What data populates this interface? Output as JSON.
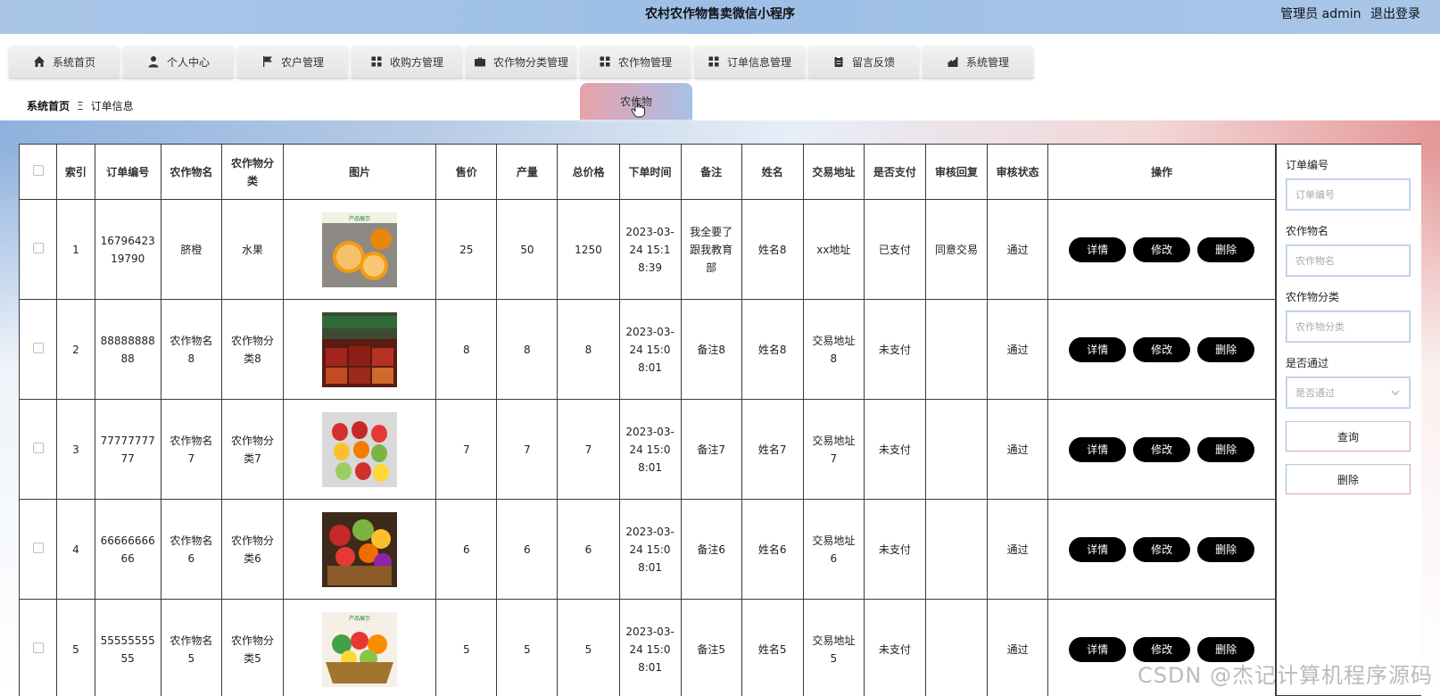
{
  "header": {
    "title": "农村农作物售卖微信小程序",
    "user_label": "管理员 admin",
    "logout_label": "退出登录"
  },
  "nav": {
    "items": [
      {
        "label": "系统首页",
        "icon": "home-icon"
      },
      {
        "label": "个人中心",
        "icon": "user-icon"
      },
      {
        "label": "农户管理",
        "icon": "flag-icon"
      },
      {
        "label": "收购方管理",
        "icon": "grid-icon"
      },
      {
        "label": "农作物分类管理",
        "icon": "briefcase-icon"
      },
      {
        "label": "农作物管理",
        "icon": "grid-icon"
      },
      {
        "label": "订单信息管理",
        "icon": "grid-icon"
      },
      {
        "label": "留言反馈",
        "icon": "clipboard-icon"
      },
      {
        "label": "系统管理",
        "icon": "settings-icon"
      }
    ],
    "dropdown_item": "农作物"
  },
  "breadcrumb": {
    "home": "系统首页",
    "separator": "Ξ",
    "current": "订单信息"
  },
  "table": {
    "headers": [
      "索引",
      "订单编号",
      "农作物名",
      "农作物分类",
      "图片",
      "售价",
      "产量",
      "总价格",
      "下单时间",
      "备注",
      "姓名",
      "交易地址",
      "是否支付",
      "审核回复",
      "审核状态",
      "操作"
    ],
    "rows": [
      {
        "index": "1",
        "order_no": "1679642319790",
        "name": "脐橙",
        "category": "水果",
        "image": "orange",
        "price": "25",
        "amount": "50",
        "total": "1250",
        "time": "2023-03-24 15:18:39",
        "note": "我全要了跟我教育部",
        "person": "姓名8",
        "address": "xx地址",
        "paid": "已支付",
        "reply": "同意交易",
        "status": "通过"
      },
      {
        "index": "2",
        "order_no": "8888888888",
        "name": "农作物名8",
        "category": "农作物分类8",
        "image": "market",
        "price": "8",
        "amount": "8",
        "total": "8",
        "time": "2023-03-24 15:08:01",
        "note": "备注8",
        "person": "姓名8",
        "address": "交易地址8",
        "paid": "未支付",
        "reply": "",
        "status": "通过"
      },
      {
        "index": "3",
        "order_no": "7777777777",
        "name": "农作物名7",
        "category": "农作物分类7",
        "image": "peppers",
        "price": "7",
        "amount": "7",
        "total": "7",
        "time": "2023-03-24 15:08:01",
        "note": "备注7",
        "person": "姓名7",
        "address": "交易地址7",
        "paid": "未支付",
        "reply": "",
        "status": "通过"
      },
      {
        "index": "4",
        "order_no": "6666666666",
        "name": "农作物名6",
        "category": "农作物分类6",
        "image": "fruit-basket",
        "price": "6",
        "amount": "6",
        "total": "6",
        "time": "2023-03-24 15:08:01",
        "note": "备注6",
        "person": "姓名6",
        "address": "交易地址6",
        "paid": "未支付",
        "reply": "",
        "status": "通过"
      },
      {
        "index": "5",
        "order_no": "5555555555",
        "name": "农作物名5",
        "category": "农作物分类5",
        "image": "veg-basket",
        "price": "5",
        "amount": "5",
        "total": "5",
        "time": "2023-03-24 15:08:01",
        "note": "备注5",
        "person": "姓名5",
        "address": "交易地址5",
        "paid": "未支付",
        "reply": "",
        "status": "通过"
      }
    ],
    "actions": {
      "detail": "详情",
      "edit": "修改",
      "delete": "删除"
    },
    "thumb_caption": "产品展示"
  },
  "search": {
    "order_no_label": "订单编号",
    "order_no_placeholder": "订单编号",
    "name_label": "农作物名",
    "name_placeholder": "农作物名",
    "category_label": "农作物分类",
    "category_placeholder": "农作物分类",
    "pass_label": "是否通过",
    "pass_placeholder": "是否通过",
    "query_button": "查询",
    "delete_button": "删除"
  },
  "watermark": "CSDN @杰记计算机程序源码"
}
